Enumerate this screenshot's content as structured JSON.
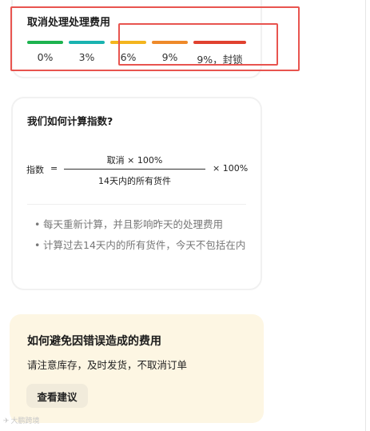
{
  "fee_card": {
    "title": "取消处理处理费用",
    "tiers": [
      {
        "label": "0%",
        "color": "#1db34f"
      },
      {
        "label": "3%",
        "color": "#19b3b0"
      },
      {
        "label": "6%",
        "color": "#f3b51e"
      },
      {
        "label": "9%",
        "color": "#ee8a2a"
      },
      {
        "label": "9%，封锁",
        "color": "#e0412f"
      }
    ],
    "highlight_color": "#e8544f"
  },
  "index_card": {
    "title": "我们如何计算指数?",
    "formula": {
      "left": "指数",
      "equals": "=",
      "numerator": "取消 × 100%",
      "denominator": "14天内的所有货件",
      "tail": "× 100%"
    },
    "notes": [
      "每天重新计算，并且影响昨天的处理费用",
      "计算过去14天内的所有货件，今天不包括在内"
    ]
  },
  "advice_card": {
    "title": "如何避免因错误造成的费用",
    "description": "请注意库存，及时发货，不取消订单",
    "button_label": "查看建议",
    "background": "#fdf6e3"
  },
  "watermark": {
    "text": "大鹏跨境"
  }
}
